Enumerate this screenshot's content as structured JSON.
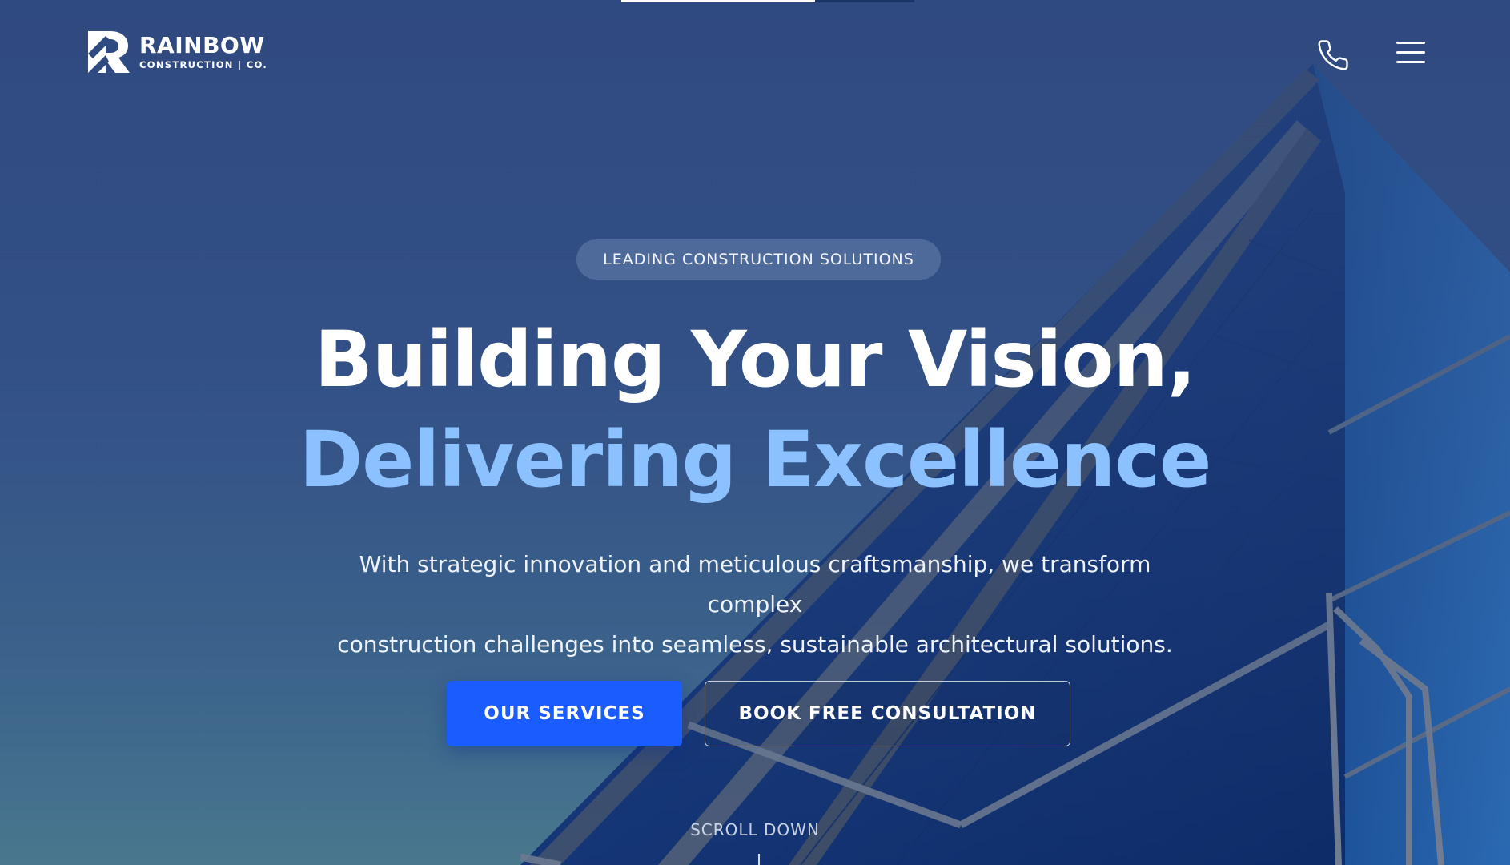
{
  "colors": {
    "primary_button": "#1a5cff",
    "headline_accent": "#8cc1ff",
    "background": "#2f4a80"
  },
  "header": {
    "logo": {
      "name": "RAINBOW",
      "subtitle": "CONSTRUCTION | CO.",
      "icon": "rainbow-r-logo-icon"
    },
    "phone_icon": "phone-icon",
    "menu_icon": "hamburger-menu-icon"
  },
  "page_progress": 0.66,
  "hero": {
    "badge": "LEADING CONSTRUCTION SOLUTIONS",
    "headline_line1": "Building Your Vision,",
    "headline_line2": "Delivering Excellence",
    "lead_line1": "With strategic innovation and meticulous craftsmanship, we transform complex",
    "lead_line2": "construction challenges into seamless, sustainable architectural solutions.",
    "primary_cta": "OUR SERVICES",
    "secondary_cta": "BOOK FREE CONSULTATION",
    "scroll_label": "SCROLL DOWN"
  }
}
